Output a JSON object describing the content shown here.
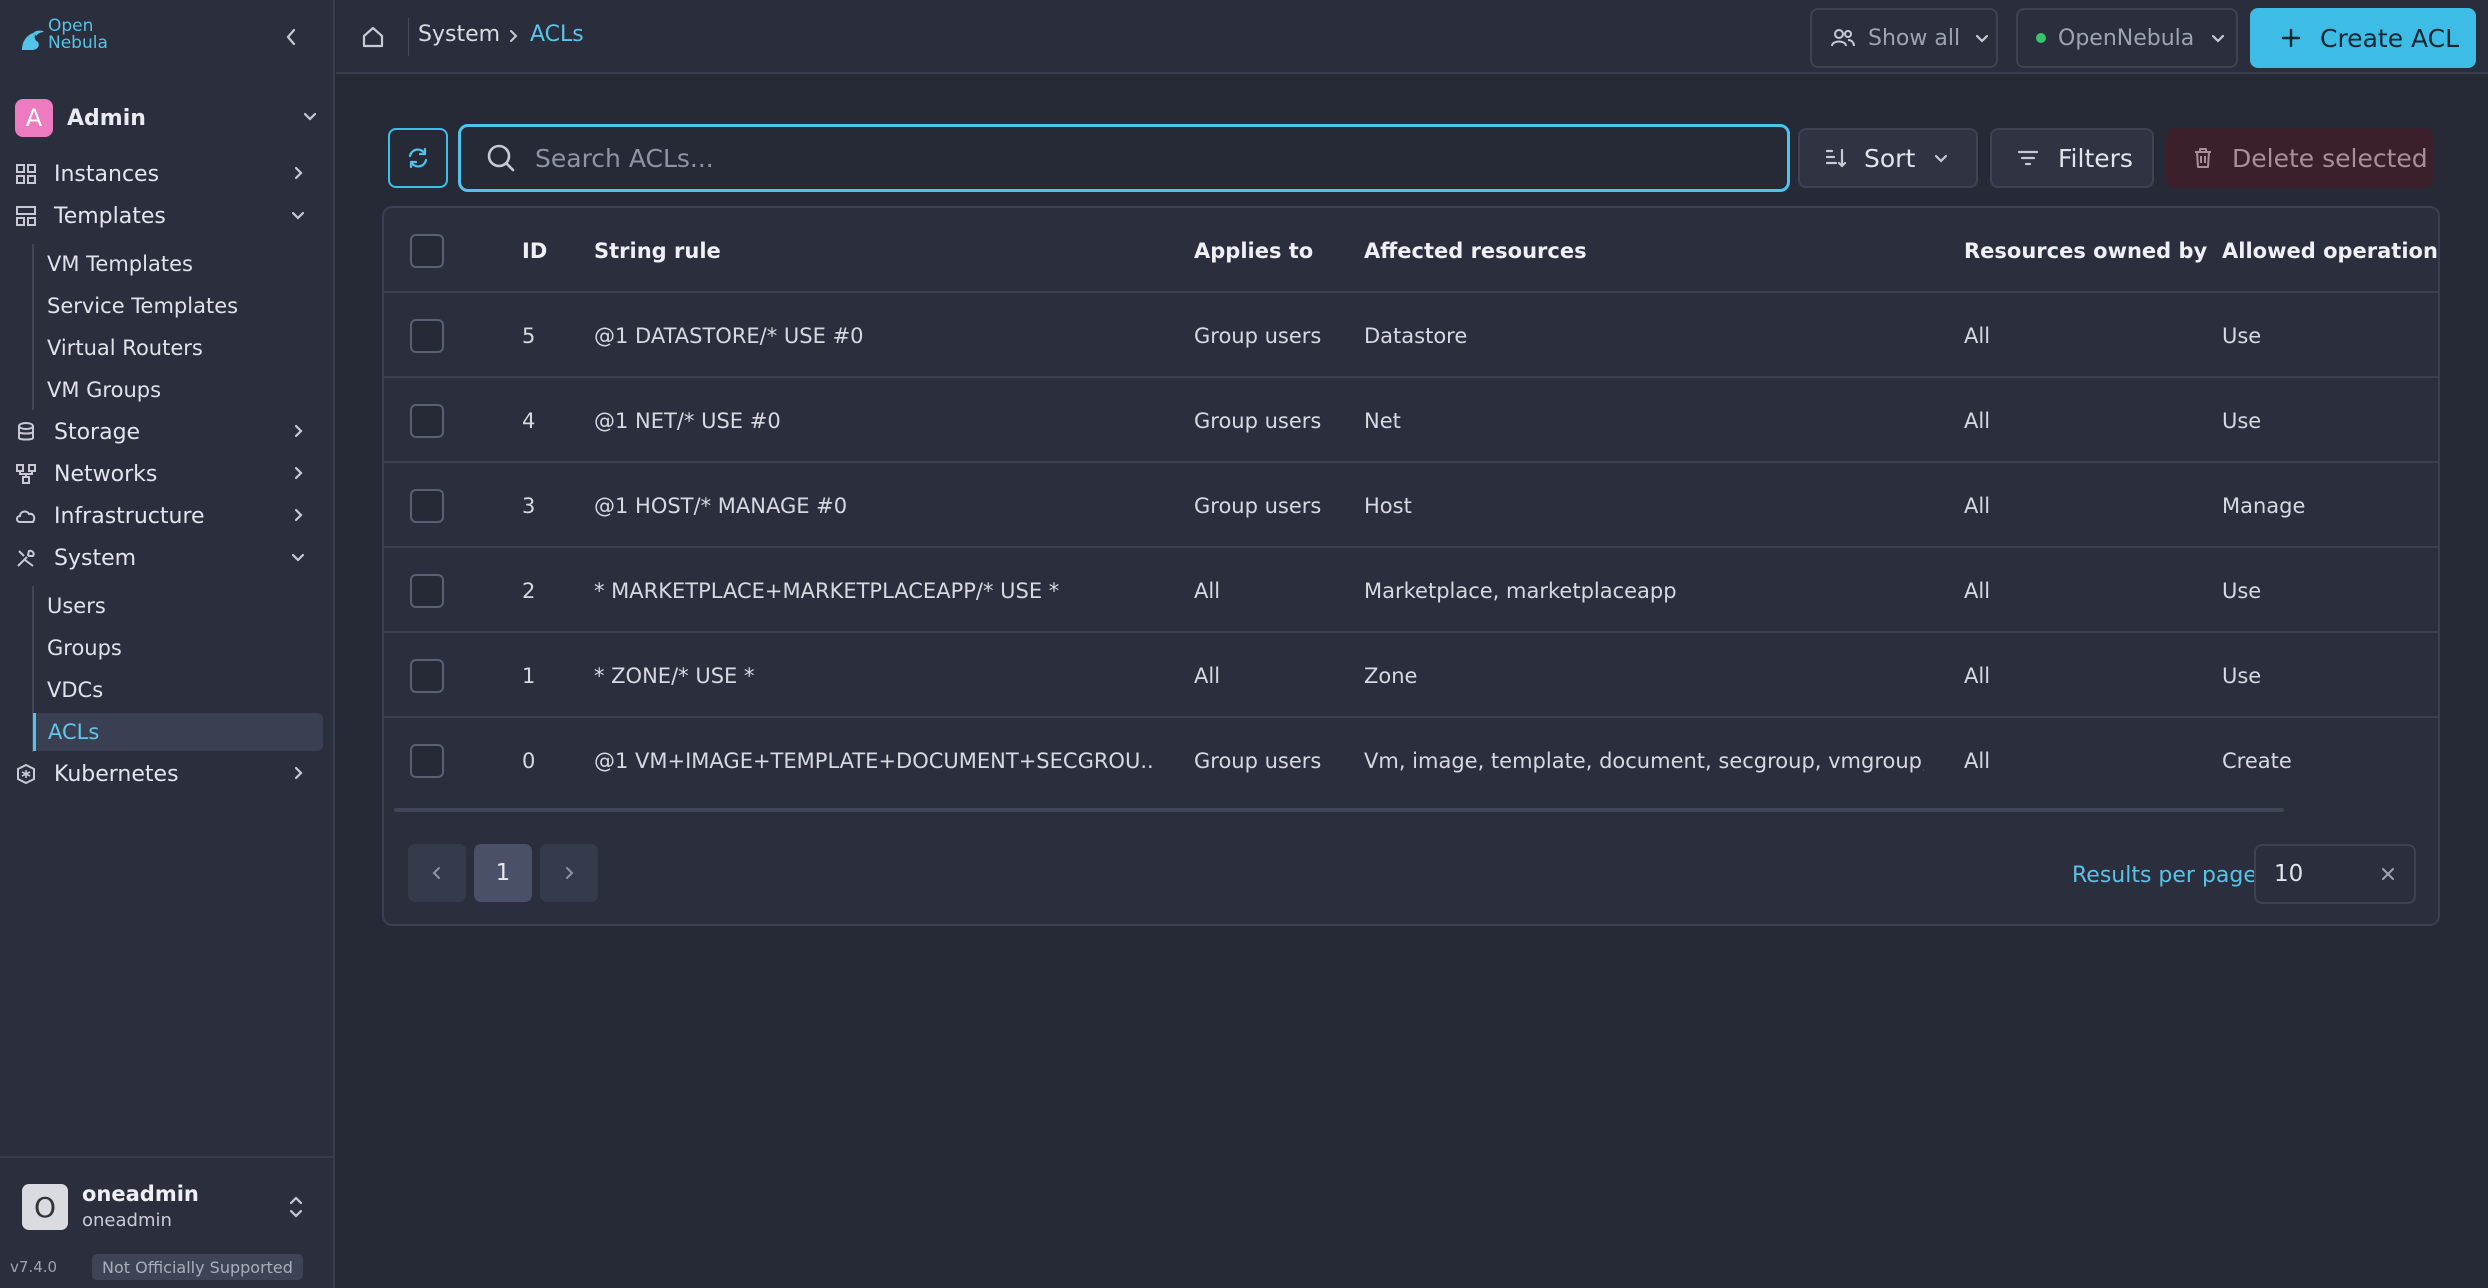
{
  "sidebar": {
    "logo_line1": "Open",
    "logo_line2": "Nebula",
    "group": {
      "initial": "A",
      "label": "Admin"
    },
    "items": [
      {
        "label": "Instances"
      },
      {
        "label": "Templates",
        "children": [
          "VM Templates",
          "Service Templates",
          "Virtual Routers",
          "VM Groups"
        ]
      },
      {
        "label": "Storage"
      },
      {
        "label": "Networks"
      },
      {
        "label": "Infrastructure"
      },
      {
        "label": "System",
        "children": [
          "Users",
          "Groups",
          "VDCs",
          "ACLs"
        ]
      },
      {
        "label": "Kubernetes"
      }
    ],
    "user": {
      "initial": "O",
      "name": "oneadmin",
      "username": "oneadmin"
    },
    "version": "v7.4.0",
    "support_badge": "Not Officially Supported"
  },
  "header": {
    "breadcrumb": [
      "System",
      "ACLs"
    ],
    "show_all_label": "Show all",
    "zone_label": "OpenNebula",
    "create_label": "Create ACL"
  },
  "toolbar": {
    "search_placeholder": "Search ACLs...",
    "sort_label": "Sort",
    "filters_label": "Filters",
    "delete_label": "Delete selected"
  },
  "table": {
    "columns": [
      "ID",
      "String rule",
      "Applies to",
      "Affected resources",
      "Resources owned by",
      "Allowed operations"
    ],
    "rows": [
      {
        "id": "5",
        "rule": "@1 DATASTORE/* USE #0",
        "applies": "Group users",
        "affected": "Datastore",
        "owned": "All",
        "ops": "Use"
      },
      {
        "id": "4",
        "rule": "@1 NET/* USE #0",
        "applies": "Group users",
        "affected": "Net",
        "owned": "All",
        "ops": "Use"
      },
      {
        "id": "3",
        "rule": "@1 HOST/* MANAGE #0",
        "applies": "Group users",
        "affected": "Host",
        "owned": "All",
        "ops": "Manage"
      },
      {
        "id": "2",
        "rule": "* MARKETPLACE+MARKETPLACEAPP/* USE *",
        "applies": "All",
        "affected": "Marketplace, marketplaceapp",
        "owned": "All",
        "ops": "Use"
      },
      {
        "id": "1",
        "rule": "* ZONE/* USE *",
        "applies": "All",
        "affected": "Zone",
        "owned": "All",
        "ops": "Use"
      },
      {
        "id": "0",
        "rule": "@1 VM+IMAGE+TEMPLATE+DOCUMENT+SECGROU...",
        "applies": "Group users",
        "affected": "Vm, image, template, document, secgroup, vmgroup, ...",
        "owned": "All",
        "ops": "Create"
      }
    ]
  },
  "pagination": {
    "current_page": "1",
    "results_per_page_label": "Results per page",
    "results_per_page": "10"
  },
  "colors": {
    "accent": "#3dbde6",
    "background": "#262a37",
    "sidebar": "#2b2f3d",
    "avatar": "#ec7bbf",
    "zone_status": "#35c46a",
    "danger_bg": "#3b1f2b"
  }
}
